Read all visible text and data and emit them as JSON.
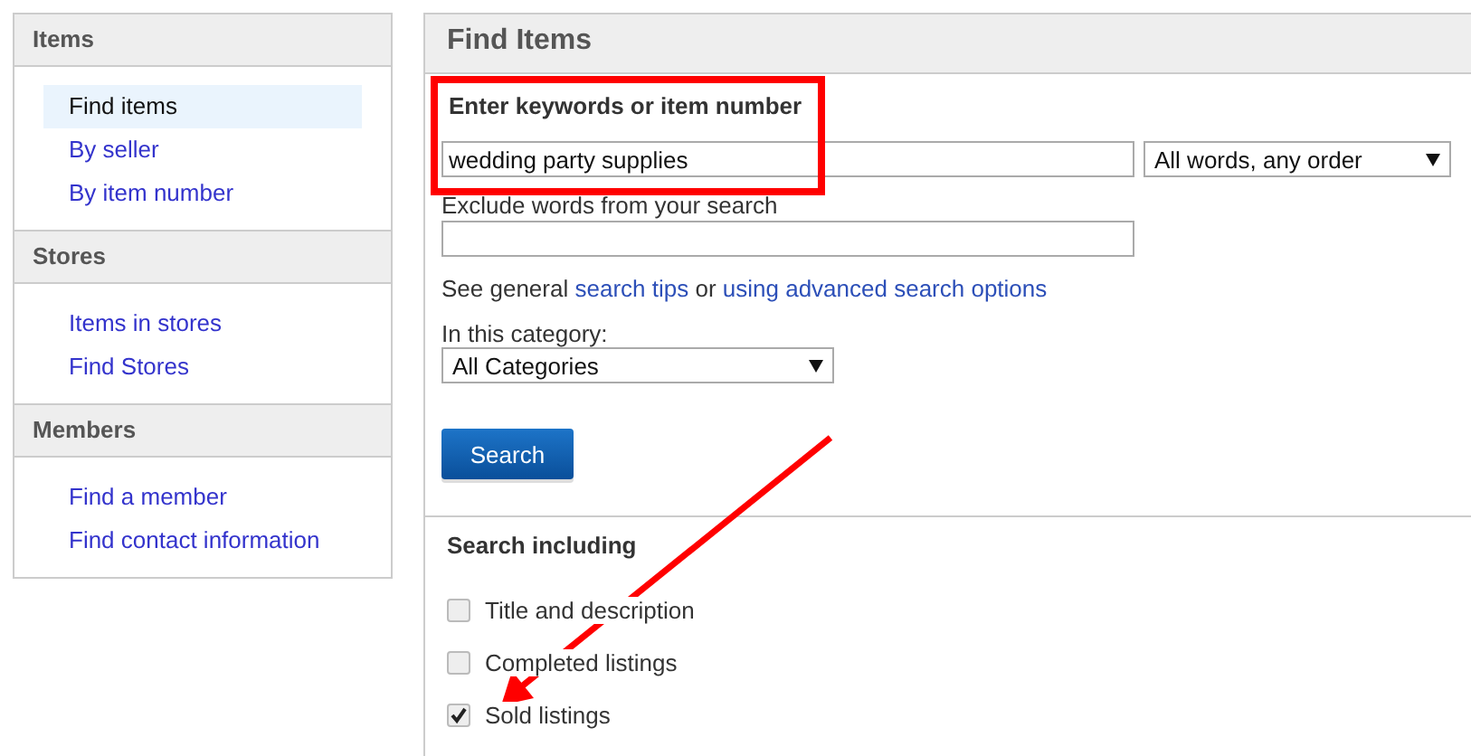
{
  "sidebar": {
    "sections": [
      {
        "title": "Items",
        "items": [
          {
            "label": "Find items",
            "selected": true
          },
          {
            "label": "By seller",
            "selected": false
          },
          {
            "label": "By item number",
            "selected": false
          }
        ]
      },
      {
        "title": "Stores",
        "items": [
          {
            "label": "Items in stores",
            "selected": false
          },
          {
            "label": "Find Stores",
            "selected": false
          }
        ]
      },
      {
        "title": "Members",
        "items": [
          {
            "label": "Find a member",
            "selected": false
          },
          {
            "label": "Find contact information",
            "selected": false
          }
        ]
      }
    ]
  },
  "panel": {
    "title": "Find Items",
    "keywords": {
      "label": "Enter keywords or item number",
      "value": "wedding party supplies",
      "match_select": "All words, any order"
    },
    "exclude": {
      "label": "Exclude words from your search"
    },
    "tips": [
      {
        "text": "See general ",
        "link": false
      },
      {
        "text": "search tips",
        "link": true
      },
      {
        "text": " or ",
        "link": false
      },
      {
        "text": "using advanced search options",
        "link": true
      }
    ],
    "category": {
      "label": "In this category:",
      "select": "All Categories"
    },
    "search_button": "Search",
    "including": {
      "title": "Search including",
      "options": [
        {
          "label": "Title and description",
          "checked": false
        },
        {
          "label": "Completed listings",
          "checked": false
        },
        {
          "label": "Sold listings",
          "checked": true
        }
      ]
    }
  }
}
